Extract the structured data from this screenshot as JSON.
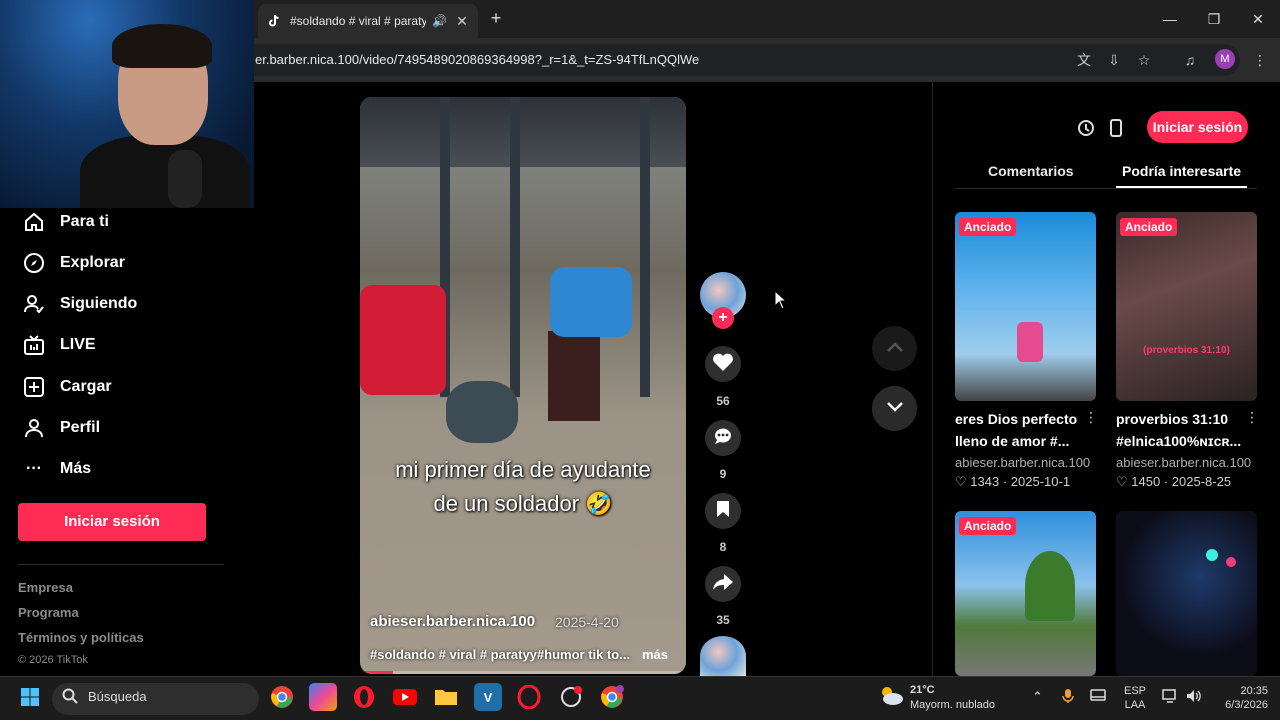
{
  "browser": {
    "tab_title": "#soldando # viral # paratyy",
    "url": "er.barber.nica.100/video/7495489020869364998?_r=1&_t=ZS-94TfLnQQlWe",
    "profile_initial": "M"
  },
  "sidebar": {
    "items": [
      {
        "label": "Para ti",
        "icon": "home-icon"
      },
      {
        "label": "Explorar",
        "icon": "compass-icon"
      },
      {
        "label": "Siguiendo",
        "icon": "following-icon"
      },
      {
        "label": "LIVE",
        "icon": "live-icon"
      },
      {
        "label": "Cargar",
        "icon": "upload-icon"
      },
      {
        "label": "Perfil",
        "icon": "profile-icon"
      },
      {
        "label": "Más",
        "icon": "more-icon"
      }
    ],
    "login_label": "Iniciar sesión",
    "footer": [
      "Empresa",
      "Programa",
      "Términos y políticas"
    ],
    "copyright": "© 2026 TikTok"
  },
  "video": {
    "caption_line1": "mi primer día de ayudante",
    "caption_line2": "de un soldador 🤣",
    "author": "abieser.barber.nica.100",
    "date": "2025-4-20",
    "description": "#soldando # viral # paratyy#humor tik to...",
    "more_label": "más",
    "progress": 0.1
  },
  "actions": {
    "likes": "56",
    "comments": "9",
    "saves": "8",
    "shares": "35"
  },
  "right_panel": {
    "login_label": "Iniciar sesión",
    "tabs": [
      "Comentarios",
      "Podría interesarte"
    ],
    "active_tab": "Podría interesarte",
    "cards": [
      {
        "badge": "Anciado",
        "title_line1": "eres Dios perfecto",
        "title_line2": "lleno de amor #...",
        "author": "abieser.barber.nica.100",
        "likes": "1343",
        "date": "2025-10-1",
        "overlay_text": ""
      },
      {
        "badge": "Anciado",
        "title_line1": "proverbios 31:10",
        "title_line2": "#elnica100%ɴɪᴄʀ...",
        "author": "abieser.barber.nica.100",
        "likes": "1450",
        "date": "2025-8-25",
        "overlay_text": "(proverbios 31:10)"
      },
      {
        "badge": "Anciado"
      }
    ]
  },
  "taskbar": {
    "search_placeholder": "Búsqueda",
    "weather_temp": "21°C",
    "weather_desc": "Mayorm. nublado",
    "lang_line1": "ESP",
    "lang_line2": "LAA",
    "time": "20:35",
    "date": "6/3/2026"
  },
  "colors": {
    "accent": "#fe2c55",
    "background": "#000000",
    "chrome_dark": "#1f1f1f"
  }
}
